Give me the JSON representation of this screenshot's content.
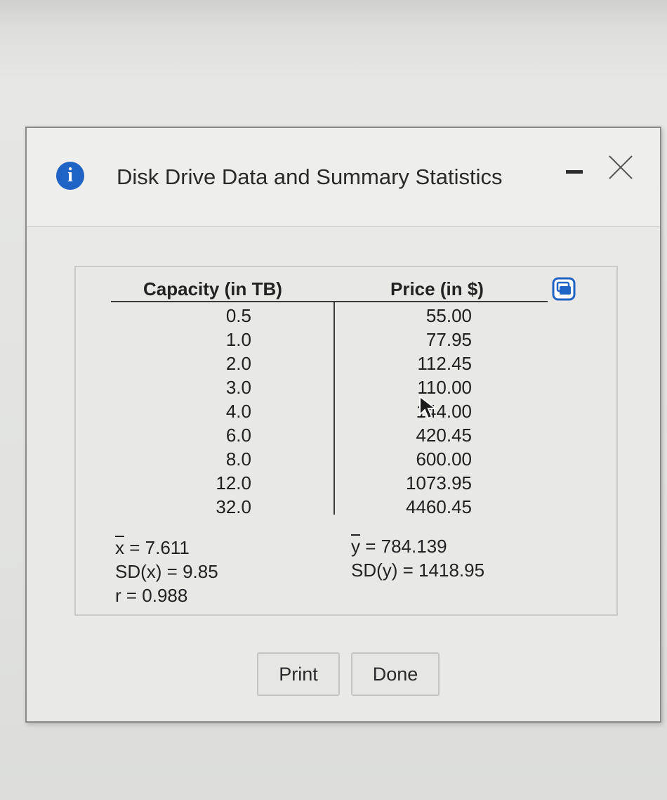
{
  "dialog": {
    "title": "Disk Drive Data and Summary Statistics",
    "info_icon_glyph": "i",
    "icons": {
      "info": "info-icon",
      "minimize": "minimize-icon",
      "close": "close-icon",
      "copy": "copy-to-clipboard-icon"
    },
    "accent_color": "#1f63c4"
  },
  "table": {
    "headers": {
      "capacity": "Capacity (in TB)",
      "price": "Price (in $)"
    },
    "capacity": [
      "0.5",
      "1.0",
      "2.0",
      "3.0",
      "4.0",
      "6.0",
      "8.0",
      "12.0",
      "32.0"
    ],
    "price": [
      "55.00",
      "77.95",
      "112.45",
      "110.00",
      "144.00",
      "420.45",
      "600.00",
      "1073.95",
      "4460.45"
    ]
  },
  "stats": {
    "xbar_symbol": "x",
    "xbar_value": "= 7.611",
    "sdx": "SD(x) = 9.85",
    "r": "r = 0.988",
    "ybar_symbol": "y",
    "ybar_value": "= 784.139",
    "sdy": "SD(y) = 1418.95"
  },
  "buttons": {
    "print": "Print",
    "done": "Done"
  }
}
